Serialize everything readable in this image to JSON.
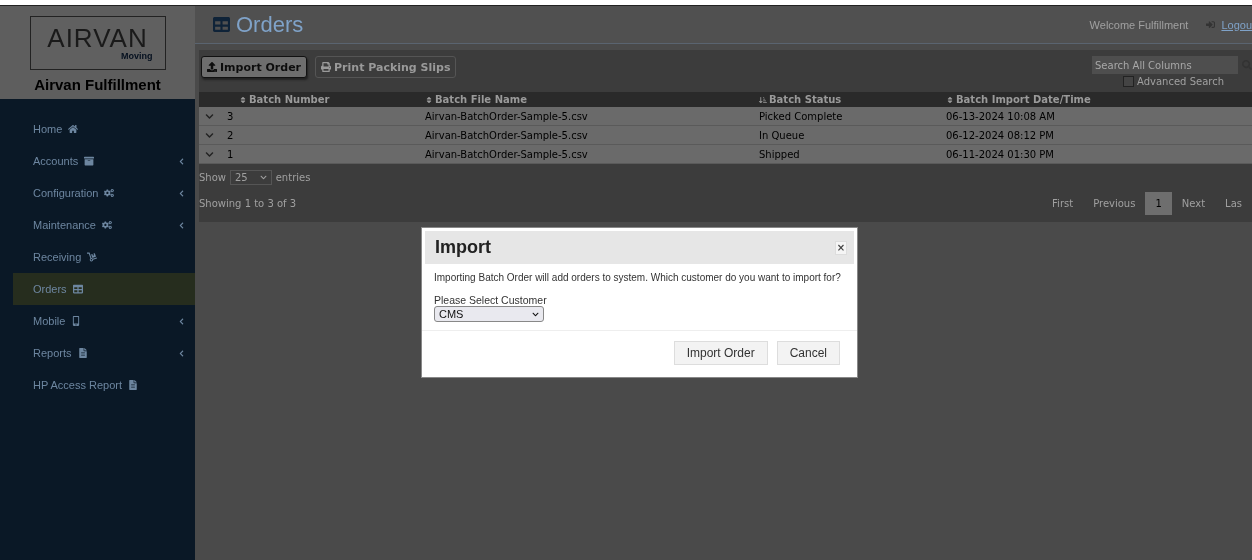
{
  "sidebar": {
    "logo": {
      "wordmark": "AIRVAN",
      "tagline": "Moving"
    },
    "brand": "Airvan Fulfillment",
    "items": [
      {
        "label": "Home",
        "submenu": false,
        "selected": false
      },
      {
        "label": "Accounts",
        "submenu": true,
        "selected": false
      },
      {
        "label": "Configuration",
        "submenu": true,
        "selected": false
      },
      {
        "label": "Maintenance",
        "submenu": true,
        "selected": false
      },
      {
        "label": "Receiving",
        "submenu": false,
        "selected": false
      },
      {
        "label": "Orders",
        "submenu": false,
        "selected": true
      },
      {
        "label": "Mobile",
        "submenu": true,
        "selected": false
      },
      {
        "label": "Reports",
        "submenu": true,
        "selected": false
      },
      {
        "label": "HP Access Report",
        "submenu": false,
        "selected": false
      }
    ]
  },
  "header": {
    "title": "Orders",
    "welcome": "Welcome Fulfillment",
    "logout": "Logou"
  },
  "toolbar": {
    "buttons": [
      {
        "label": "Import Order",
        "disabled": false
      },
      {
        "label": "Print Packing Slips",
        "disabled": true
      }
    ],
    "search": {
      "placeholder": "Search All Columns"
    },
    "advanced_search": {
      "label": "Advanced Search",
      "checked": false
    }
  },
  "table": {
    "columns": [
      {
        "label": "Batch Number",
        "sorted": false
      },
      {
        "label": "Batch File Name",
        "sorted": false
      },
      {
        "label": "Batch Status",
        "sorted": true
      },
      {
        "label": "Batch Import Date/Time",
        "sorted": false
      }
    ],
    "rows": [
      [
        "3",
        "Airvan-BatchOrder-Sample-5.csv",
        "Picked Complete",
        "06-13-2024 10:08 AM"
      ],
      [
        "2",
        "Airvan-BatchOrder-Sample-5.csv",
        "In Queue",
        "06-12-2024 08:12 PM"
      ],
      [
        "1",
        "Airvan-BatchOrder-Sample-5.csv",
        "Shipped",
        "06-11-2024 01:30 PM"
      ]
    ]
  },
  "length": {
    "before": "Show",
    "value": "25",
    "after": "entries"
  },
  "info": "Showing 1 to 3 of 3",
  "pagination": [
    {
      "label": "First",
      "selected": false
    },
    {
      "label": "Previous",
      "selected": false
    },
    {
      "label": "1",
      "selected": true
    },
    {
      "label": "Next",
      "selected": false
    },
    {
      "label": "Las",
      "selected": false
    }
  ],
  "modal": {
    "title": "Import",
    "close": "×",
    "message": "Importing Batch Order will add orders to system. Which customer do you want to import for?",
    "field_label": "Please Select Customer",
    "customer": "CMS",
    "buttons": [
      "Import Order",
      "Cancel"
    ]
  }
}
